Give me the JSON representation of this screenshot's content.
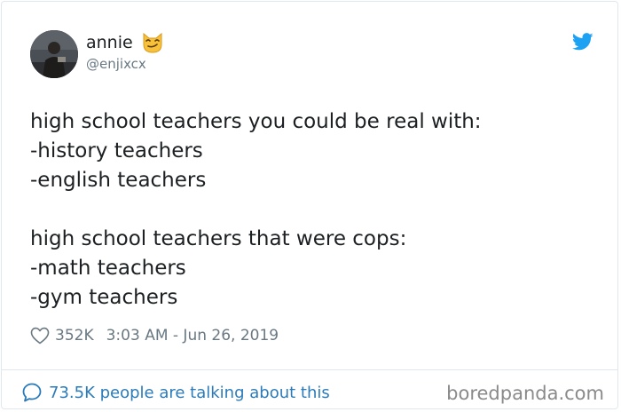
{
  "author": {
    "name": "annie",
    "handle": "@enjixcx",
    "name_emoji": "smirking-cat-emoji"
  },
  "tweet": {
    "lines": [
      "high school teachers you could be real with:",
      "-history teachers",
      "-english teachers",
      "",
      "high school teachers that were cops:",
      "-math teachers",
      "-gym teachers"
    ]
  },
  "meta": {
    "likes": "352K",
    "timestamp": "3:03 AM - Jun 26, 2019"
  },
  "footer": {
    "talking": "73.5K people are talking about this",
    "watermark": "boredpanda.com"
  },
  "icons": {
    "brand": "twitter-bird-icon",
    "like": "heart-icon",
    "reply": "speech-bubble-icon"
  },
  "colors": {
    "text": "#1c2022",
    "secondary": "#697882",
    "link": "#2b7bb9",
    "twitter_blue": "#1da1f2",
    "border": "#e1e8ed"
  }
}
